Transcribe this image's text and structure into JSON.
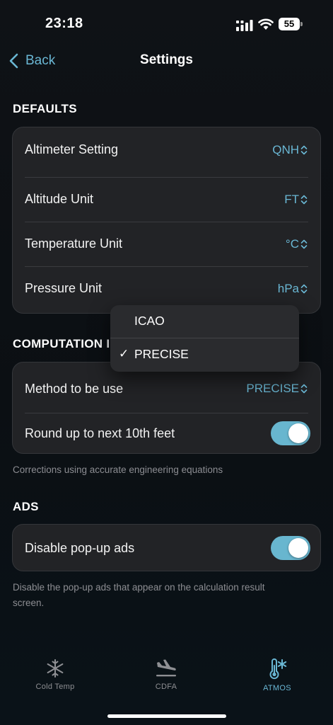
{
  "status_bar": {
    "time": "23:18",
    "battery": "55"
  },
  "nav": {
    "back_label": "Back",
    "title": "Settings"
  },
  "defaults": {
    "header": "DEFAULTS",
    "rows": [
      {
        "label": "Altimeter Setting",
        "value": "QNH"
      },
      {
        "label": "Altitude Unit",
        "value": "FT"
      },
      {
        "label": "Temperature Unit",
        "value": "°C"
      },
      {
        "label": "Pressure Unit",
        "value": "hPa"
      }
    ]
  },
  "computation": {
    "header": "COMPUTATION I",
    "method_label": "Method to be use",
    "method_value": "PRECISE",
    "round_label": "Round up to next 10th feet",
    "round_on": true,
    "footnote": "Corrections using accurate engineering equations"
  },
  "dropdown": {
    "options": [
      "ICAO",
      "PRECISE"
    ],
    "selected": "PRECISE",
    "check": "✓"
  },
  "ads": {
    "header": "ADS",
    "disable_label": "Disable pop-up ads",
    "disable_on": true,
    "footnote": "Disable the pop-up ads that appear on the calculation result screen."
  },
  "tabs": [
    {
      "label": "Cold Temp",
      "icon": "snowflake-icon",
      "active": false
    },
    {
      "label": "CDFA",
      "icon": "plane-landing-icon",
      "active": false
    },
    {
      "label": "ATMOS",
      "icon": "thermometer-snowflake-icon",
      "active": true
    }
  ],
  "colors": {
    "accent": "#6ab7d4",
    "toggle_on": "#68b6cf",
    "card_bg": "#222326",
    "inactive_tab": "#8e8f93"
  }
}
